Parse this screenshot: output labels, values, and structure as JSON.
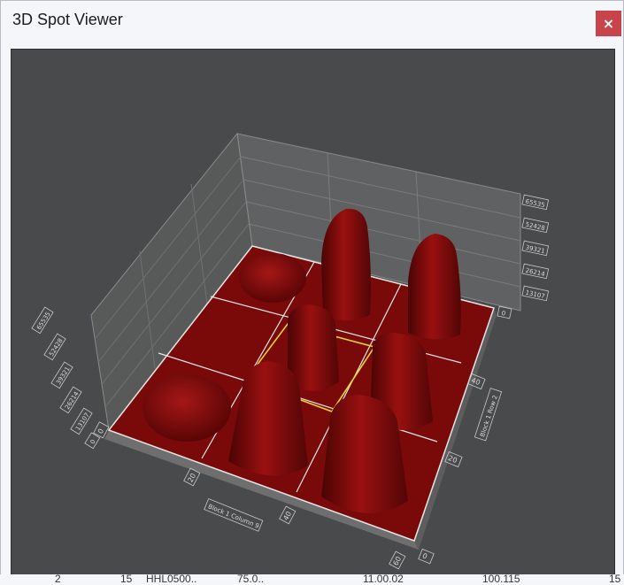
{
  "window": {
    "title": "3D Spot Viewer",
    "close_glyph": "×"
  },
  "plot": {
    "surface_color": "#7a0a0a",
    "peak_color": "#8e0c0c",
    "highlight_color": "#e8d235",
    "z_ticks_right": [
      "65535",
      "52428",
      "39321",
      "26214",
      "13107",
      "0"
    ],
    "z_ticks_left": [
      "65535",
      "52428",
      "39321",
      "26214",
      "13107",
      "0"
    ],
    "x_ticks": [
      "0",
      "20",
      "40",
      "60"
    ],
    "y_ticks": [
      "0",
      "20",
      "40"
    ],
    "x_label": "Block 1 Column 9",
    "y_label": "Block 1 Row 2"
  },
  "behind": [
    "2",
    "15",
    "HHL0500..",
    "75.0..",
    "11.00.02",
    "100.115",
    "15"
  ]
}
